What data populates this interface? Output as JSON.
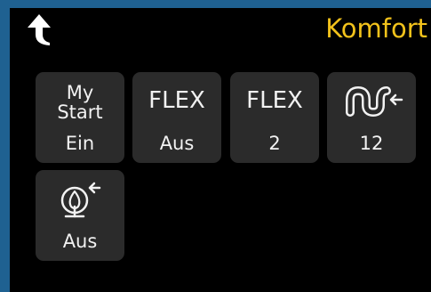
{
  "header": {
    "title": "Komfort",
    "back_icon": "up-arrow-back-icon"
  },
  "colors": {
    "frame": "#1f6191",
    "background": "#000000",
    "tile": "#2b2b2b",
    "title": "#f2c21b",
    "text": "#f2f2f2"
  },
  "tiles": [
    {
      "label": "My\nStart",
      "value": "Ein"
    },
    {
      "label": "FLEX",
      "value": "Aus"
    },
    {
      "label": "FLEX",
      "value": "2"
    },
    {
      "icon": "pipe-circulation-icon",
      "value": "12"
    },
    {
      "icon": "steam-nozzle-icon",
      "value": "Aus"
    }
  ]
}
